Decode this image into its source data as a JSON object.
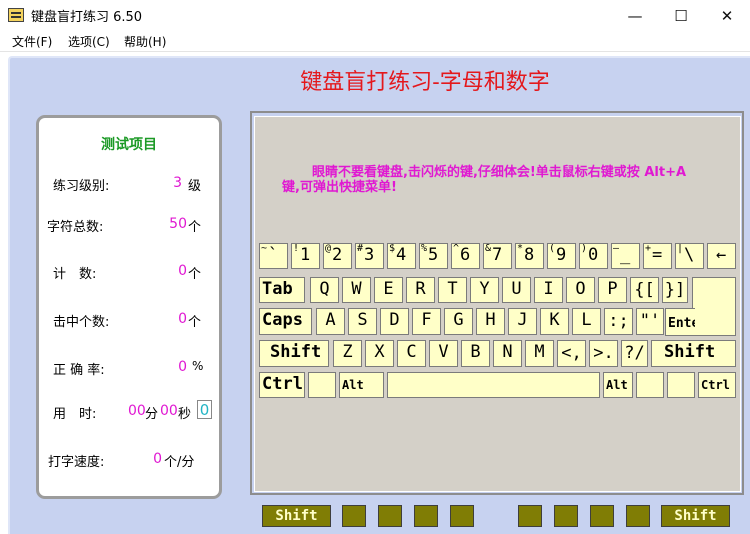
{
  "window": {
    "title": "键盘盲打练习 6.50",
    "minimize_glyph": "—",
    "maximize_glyph": "☐",
    "close_glyph": "✕"
  },
  "menu": [
    "文件(F)",
    "选项(C)",
    "帮助(H)"
  ],
  "main_title": "键盘盲打练习-字母和数字",
  "stats": {
    "title": "测试项目",
    "level_label": "练习级别:",
    "level_value": "3",
    "level_unit": "级",
    "total_label": "字符总数:",
    "total_value": "50",
    "total_unit": "个",
    "count_label": "计　数:",
    "count_value": "0",
    "count_unit": "个",
    "hits_label": "击中个数:",
    "hits_value": "0",
    "hits_unit": "个",
    "accuracy_label": "正 确 率:",
    "accuracy_value": "0",
    "accuracy_unit": "%",
    "time_label": "用　时:",
    "time_minutes": "00",
    "time_min_unit": "分",
    "time_seconds": "00",
    "time_sec_unit": "秒",
    "time_box": "0",
    "speed_label": "打字速度:",
    "speed_value": "0",
    "speed_unit": "个/分"
  },
  "instruction": "眼睛不要看键盘,击闪烁的键,仔细体会!单击鼠标右键或按 Alt+A 键,可弹出快捷菜单!",
  "keyboard": {
    "row1": [
      {
        "top": "~",
        "main": "`"
      },
      {
        "top": "!",
        "main": "1"
      },
      {
        "top": "@",
        "main": "2"
      },
      {
        "top": "#",
        "main": "3"
      },
      {
        "top": "$",
        "main": "4"
      },
      {
        "top": "%",
        "main": "5"
      },
      {
        "top": "^",
        "main": "6"
      },
      {
        "top": "&",
        "main": "7"
      },
      {
        "top": "*",
        "main": "8"
      },
      {
        "top": "(",
        "main": "9"
      },
      {
        "top": ")",
        "main": "0"
      },
      {
        "top": "—",
        "main": "_"
      },
      {
        "top": "+",
        "main": "="
      },
      {
        "top": "|",
        "main": "\\"
      },
      {
        "top": "",
        "main": "←"
      }
    ],
    "row2": [
      "Tab",
      "Q",
      "W",
      "E",
      "R",
      "T",
      "Y",
      "U",
      "I",
      "O",
      "P",
      "{[",
      "}]"
    ],
    "enter": "Enter↵",
    "row3": [
      "Caps",
      "A",
      "S",
      "D",
      "F",
      "G",
      "H",
      "J",
      "K",
      "L",
      ":;",
      "\"'"
    ],
    "row4": [
      "Shift",
      "Z",
      "X",
      "C",
      "V",
      "B",
      "N",
      "M",
      "<,",
      ">.",
      "?/",
      "Shift"
    ],
    "row5": [
      "Ctrl",
      "",
      "Alt",
      "",
      "Alt",
      "",
      "",
      "Ctrl"
    ]
  },
  "indicators": [
    "Shift",
    "",
    "",
    "",
    "",
    "",
    "",
    "",
    "",
    "Shift"
  ]
}
